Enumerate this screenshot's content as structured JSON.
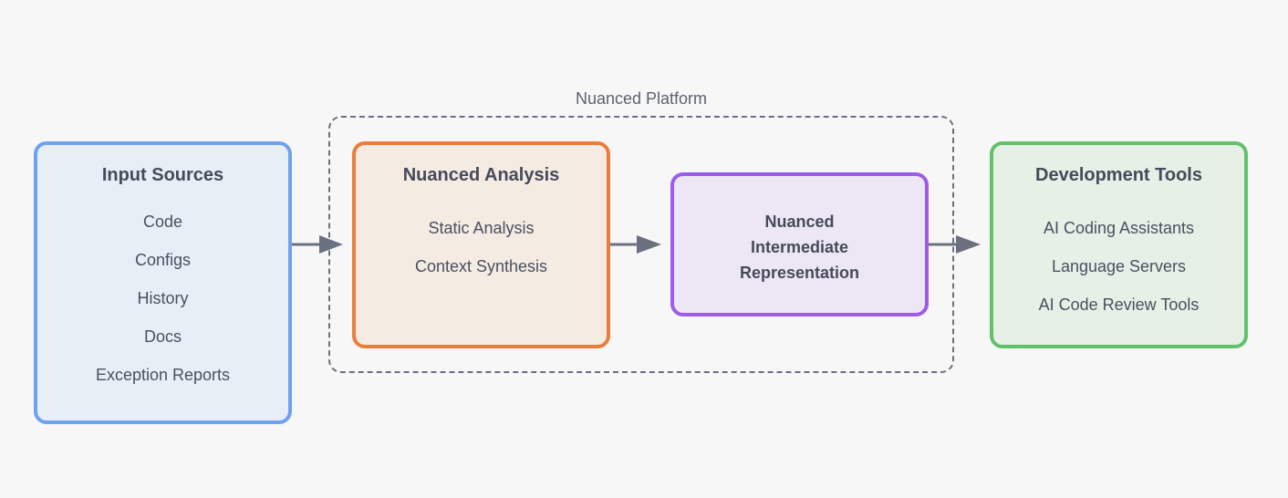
{
  "platform": {
    "label": "Nuanced Platform"
  },
  "nodes": {
    "input_sources": {
      "title": "Input Sources",
      "items": [
        "Code",
        "Configs",
        "History",
        "Docs",
        "Exception Reports"
      ],
      "border_color": "#6ea2ee",
      "fill_color": "#e8eef6"
    },
    "nuanced_analysis": {
      "title": "Nuanced Analysis",
      "items": [
        "Static Analysis",
        "Context Synthesis"
      ],
      "border_color": "#eb7d3a",
      "fill_color": "#f4ebe3"
    },
    "nuanced_ir": {
      "title_lines": [
        "Nuanced",
        "Intermediate",
        "Representation"
      ],
      "border_color": "#9d5bea",
      "fill_color": "#ede6f4"
    },
    "development_tools": {
      "title": "Development Tools",
      "items": [
        "AI Coding Assistants",
        "Language Servers",
        "AI Code Review Tools"
      ],
      "border_color": "#62c26a",
      "fill_color": "#e6f0e6"
    }
  },
  "edges": [
    {
      "from": "input_sources",
      "to": "nuanced_analysis"
    },
    {
      "from": "nuanced_analysis",
      "to": "nuanced_ir"
    },
    {
      "from": "nuanced_ir",
      "to": "development_tools"
    }
  ],
  "colors": {
    "arrow": "#6b7080",
    "background": "#f7f7f7"
  }
}
